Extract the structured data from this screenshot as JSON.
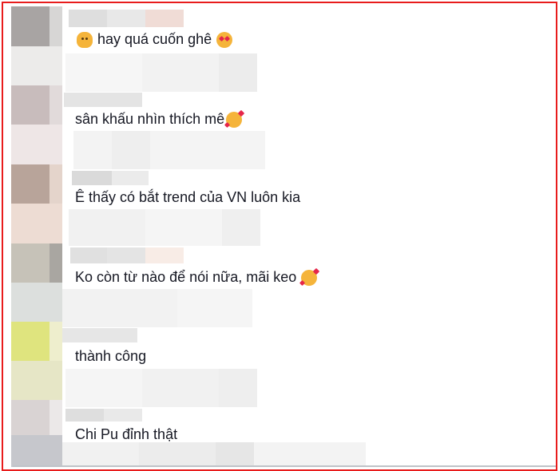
{
  "comments": [
    {
      "text": "hay quá cuốn ghê",
      "lead_icon": "hugging-face-icon",
      "trail_icon": "heart-eyes-emoji-icon"
    },
    {
      "text": "sân khấu nhìn thích mê",
      "trail_icon": "smiling-face-with-hearts-icon"
    },
    {
      "text": "Ê thấy có bắt trend của VN luôn kia"
    },
    {
      "text": "Ko còn từ nào để nói nữa, mãi keo",
      "trail_icon": "smiling-face-with-hearts-icon"
    },
    {
      "text": "thành công"
    },
    {
      "text": "Chi Pu đỉnh thật"
    }
  ],
  "colors": {
    "frame_border": "#e81c1c",
    "text": "#161823",
    "avatar_tiles": [
      "#a8a4a3",
      "#ecebea",
      "#c8bcbc",
      "#eee6e6",
      "#b8a49a",
      "#eddcd3",
      "#c6c2b8",
      "#dcdfdd",
      "#dfe47e",
      "#e6e6c6",
      "#d9d3d3",
      "#c6c7cc"
    ]
  }
}
